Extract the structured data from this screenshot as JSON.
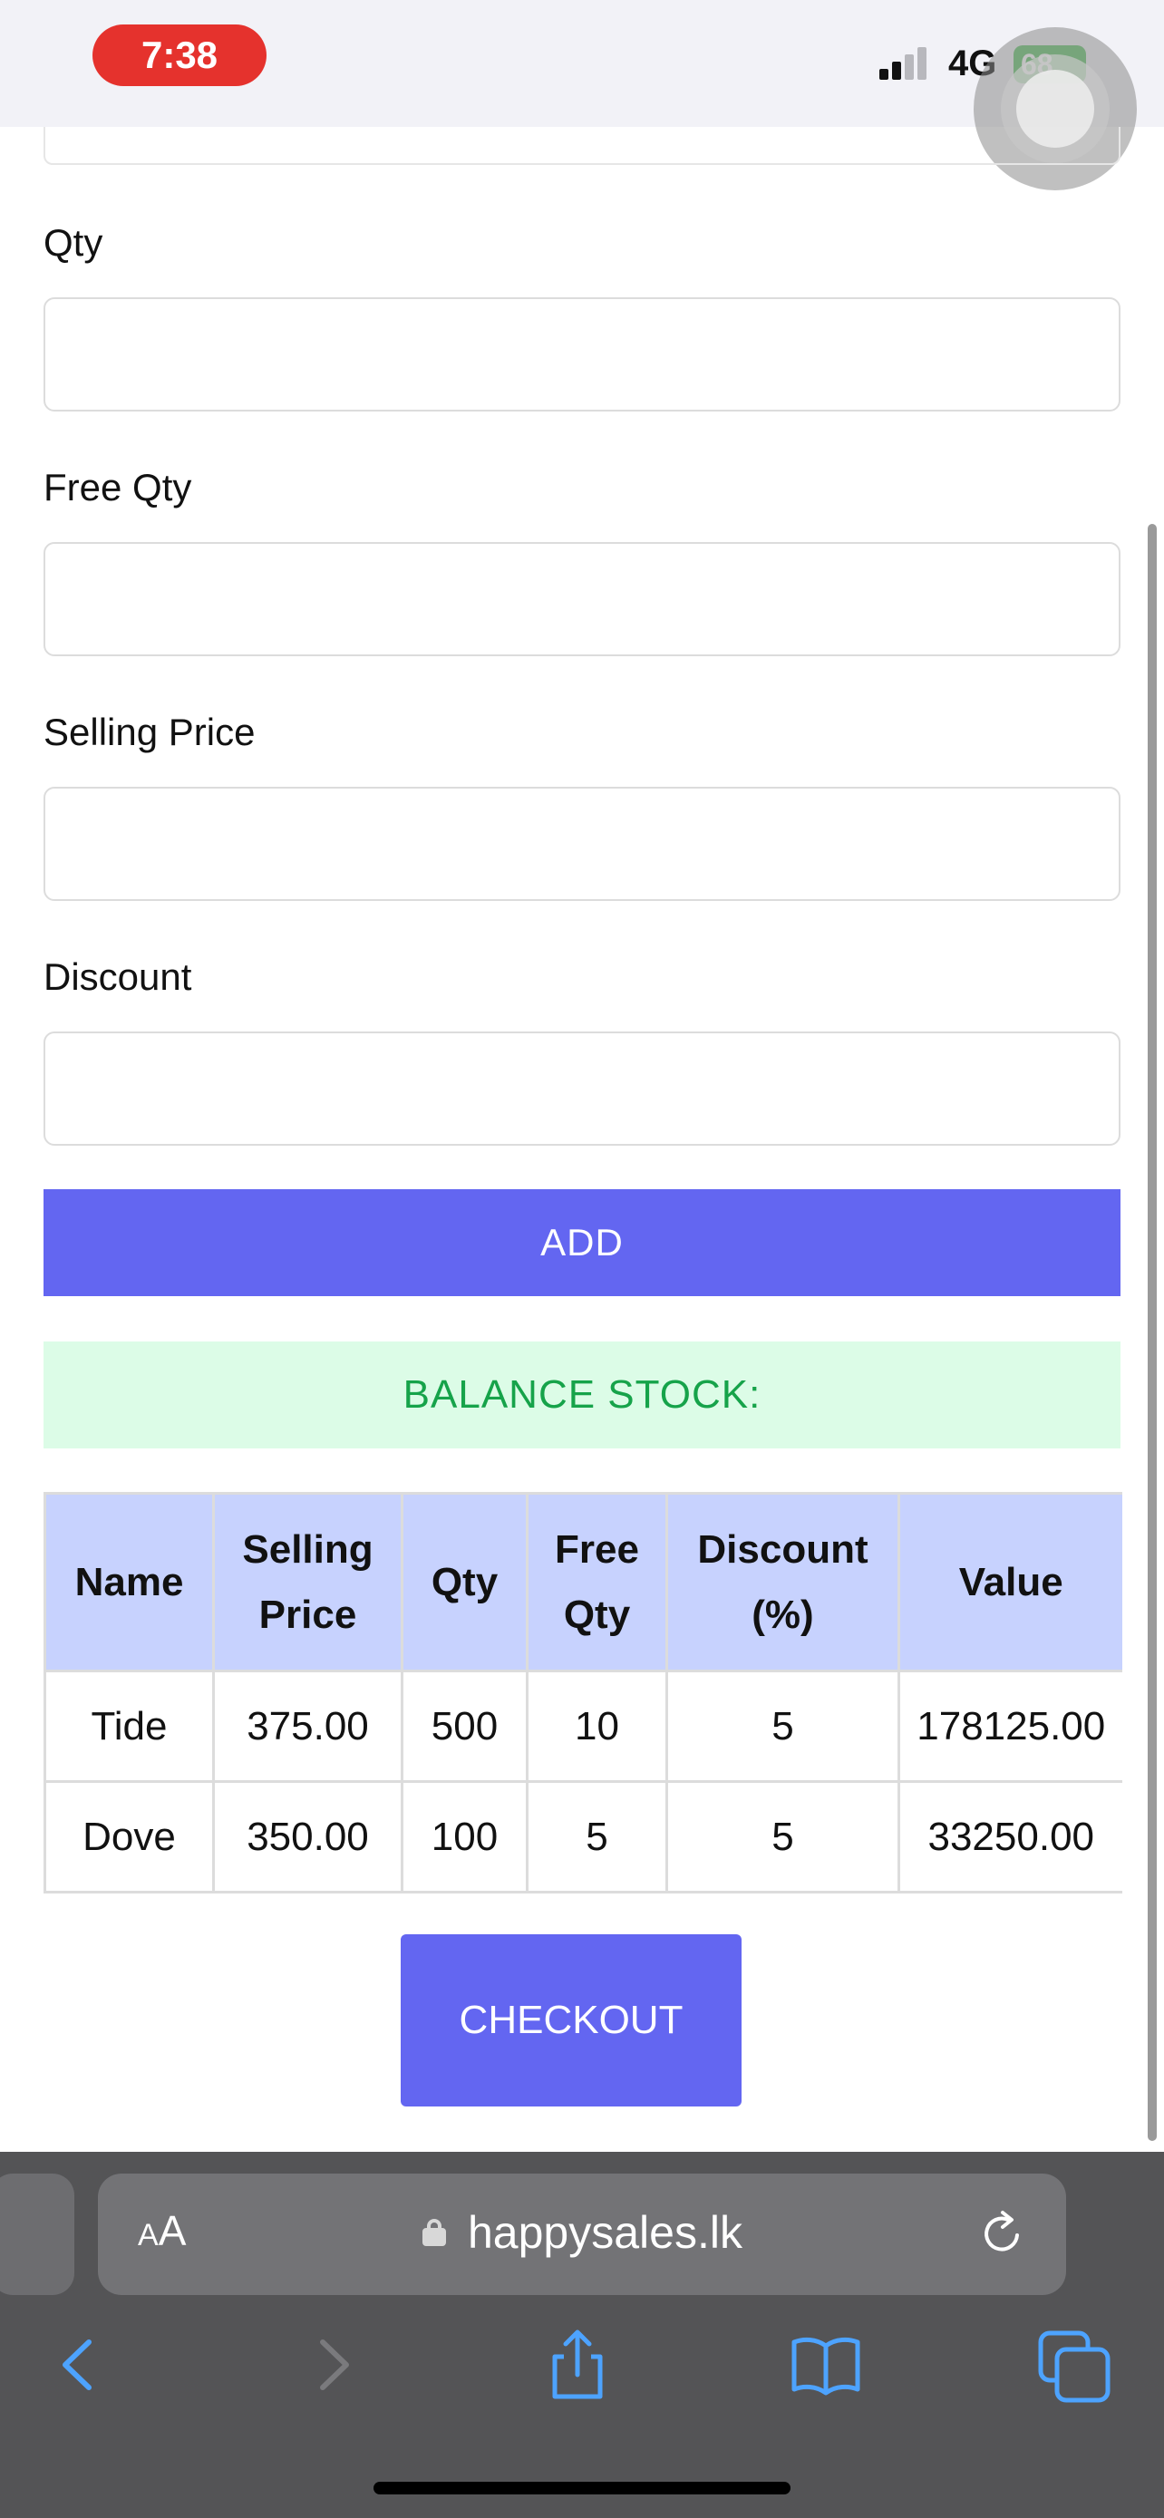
{
  "status": {
    "time": "7:38",
    "network": "4G",
    "battery": "68"
  },
  "form": {
    "qty_label": "Qty",
    "qty_value": "",
    "free_qty_label": "Free Qty",
    "free_qty_value": "",
    "selling_price_label": "Selling Price",
    "selling_price_value": "",
    "discount_label": "Discount",
    "discount_value": "",
    "add_label": "ADD",
    "balance_label": "BALANCE STOCK:"
  },
  "table": {
    "headers": [
      "Name",
      "Selling Price",
      "Qty",
      "Free Qty",
      "Discount (%)",
      "Value"
    ],
    "rows": [
      [
        "Tide",
        "375.00",
        "500",
        "10",
        "5",
        "178125.00"
      ],
      [
        "Dove",
        "350.00",
        "100",
        "5",
        "5",
        "33250.00"
      ]
    ]
  },
  "checkout_label": "CHECKOUT",
  "browser": {
    "aa_label": "AA",
    "url": "happysales.lk"
  },
  "colors": {
    "accent": "#6366f1",
    "balance_bg": "#dcfce7",
    "balance_text": "#16a34a",
    "header_bg": "#c7d2fe"
  }
}
